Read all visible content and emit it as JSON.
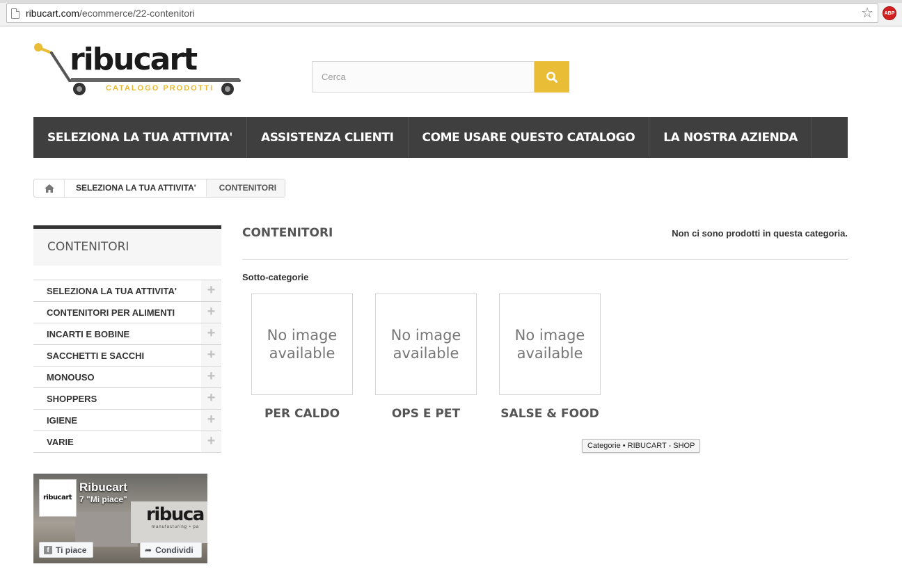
{
  "browser": {
    "url_host": "ribucart.com",
    "url_path": "/ecommerce/22-contenitori",
    "extension_label": "ABP"
  },
  "header": {
    "logo_text": "ribucart",
    "logo_tagline": "CATALOGO PRODOTTI",
    "search_placeholder": "Cerca",
    "accent_color": "#e9bd35"
  },
  "nav": {
    "items": [
      "SELEZIONA LA TUA ATTIVITA'",
      "ASSISTENZA CLIENTI",
      "COME USARE QUESTO CATALOGO",
      "LA NOSTRA AZIENDA"
    ]
  },
  "breadcrumb": {
    "parent": "SELEZIONA LA TUA ATTIVITA'",
    "current": "CONTENITORI"
  },
  "sidebar": {
    "title": "CONTENITORI",
    "items": [
      "SELEZIONA LA TUA ATTIVITA'",
      "CONTENITORI PER ALIMENTI",
      "INCARTI E BOBINE",
      "SACCHETTI E SACCHI",
      "MONOUSO",
      "SHOPPERS",
      "IGIENE",
      "VARIE"
    ],
    "expand_glyph": "+"
  },
  "facebook": {
    "page_name": "Ribucart",
    "likes": "7 \"Mi piace\"",
    "thumb_text": "ribucart",
    "cover_text": "ribuca",
    "cover_sub": "manufacturing • pa",
    "like_button": "Ti piace",
    "share_button": "Condividi"
  },
  "main": {
    "heading": "CONTENITORI",
    "empty_message": "Non ci sono prodotti in questa categoria.",
    "subcategories_title": "Sotto-categorie",
    "no_image_text": "No image available",
    "subcategories": [
      "PER CALDO",
      "OPS E PET",
      "SALSE & FOOD"
    ],
    "tooltip": "Categorie • RIBUCART - SHOP"
  }
}
